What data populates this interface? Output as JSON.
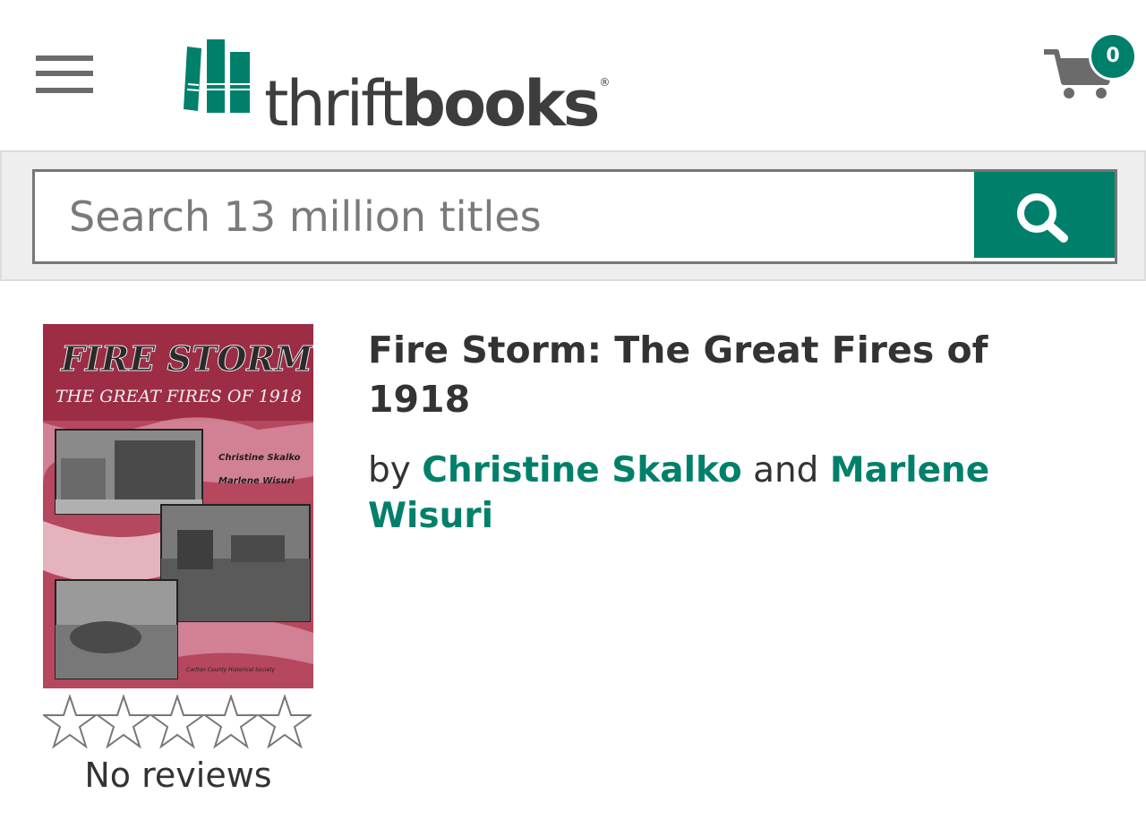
{
  "header": {
    "logo": {
      "part1": "thrift",
      "part2": "books",
      "registered": "®"
    },
    "cart_count": "0",
    "colors": {
      "brand": "#00806b",
      "text": "#333333"
    }
  },
  "search": {
    "placeholder": "Search 13 million titles",
    "value": ""
  },
  "book": {
    "cover": {
      "title_line1": "FIRE  STORM",
      "title_line2": "THE GREAT FIRES OF 1918",
      "author1": "Christine Skalko",
      "author2": "Marlene Wisuri",
      "publisher": "Carlton County Historical Society"
    },
    "title": "Fire Storm: The Great Fires of 1918",
    "by": "by",
    "and": "and",
    "authors": [
      "Christine Skalko",
      "Marlene Wisuri"
    ],
    "rating": {
      "stars_filled": 0,
      "stars_total": 5
    },
    "reviews_text": "No reviews"
  }
}
